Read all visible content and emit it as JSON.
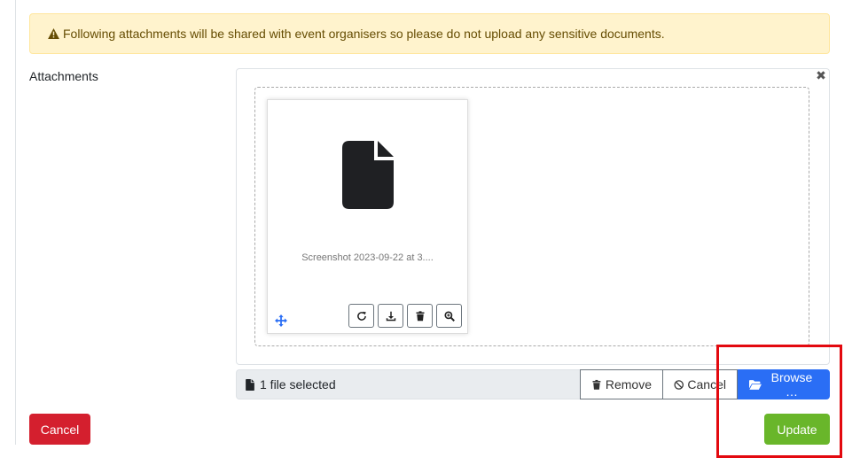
{
  "alert": {
    "icon": "warning-triangle-icon",
    "text": "Following attachments will be shared with event organisers so please do not upload any sensitive documents.",
    "bg_color": "#fff3cd",
    "text_color": "#664d03"
  },
  "attachments": {
    "label": "Attachments",
    "preview": {
      "close_icon": "close-icon",
      "file": {
        "icon": "file-icon",
        "name": "Screenshot 2023-09-22 at 3...."
      },
      "actions": [
        {
          "name": "rotate-icon"
        },
        {
          "name": "download-icon"
        },
        {
          "name": "trash-icon"
        },
        {
          "name": "zoom-icon"
        }
      ],
      "drag_icon": "move-arrows-icon"
    },
    "file_bar": {
      "caption": "1 file selected",
      "remove_label": "Remove",
      "cancel_label": "Cancel",
      "browse_label": "Browse …",
      "browse_color": "#2a6ef5"
    }
  },
  "footer": {
    "cancel_label": "Cancel",
    "update_label": "Update",
    "cancel_color": "#d41f2e",
    "update_color": "#69b62a"
  },
  "highlight": {
    "color": "#e3090f"
  }
}
